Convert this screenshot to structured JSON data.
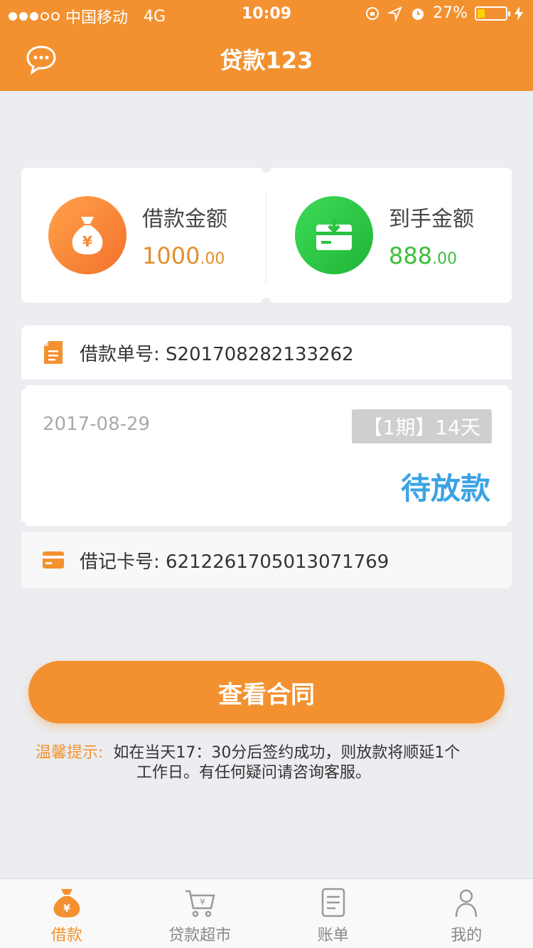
{
  "status_bar": {
    "carrier": "中国移动",
    "network": "4G",
    "time": "10:09",
    "battery": "27%",
    "battery_level": 0.27
  },
  "nav": {
    "title": "贷款123",
    "left_icon": "chat-bubble-icon"
  },
  "amounts": {
    "loan": {
      "label": "借款金额",
      "integer": "1000",
      "decimal": ".00",
      "color": "#e38f2a",
      "icon": "money-bag-icon"
    },
    "received": {
      "label": "到手金额",
      "integer": "888",
      "decimal": ".00",
      "color": "#3dbf3a",
      "icon": "card-download-icon"
    }
  },
  "order": {
    "number_label": "借款单号: S201708282133262",
    "date": "2017-08-29",
    "period": "【1期】14天",
    "status": "待放款",
    "card_label": "借记卡号: 6212261705013071769"
  },
  "button": {
    "label": "查看合同"
  },
  "tip": {
    "label": "温馨提示:",
    "line1": "如在当天17：30分后签约成功，则放款将顺延1个",
    "line2": "工作日。有任何疑问请咨询客服。"
  },
  "tabs": [
    {
      "label": "借款",
      "icon": "money-bag-icon",
      "active": true
    },
    {
      "label": "贷款超市",
      "icon": "shopping-cart-icon",
      "active": false
    },
    {
      "label": "账单",
      "icon": "bill-icon",
      "active": false
    },
    {
      "label": "我的",
      "icon": "person-icon",
      "active": false
    }
  ],
  "colors": {
    "primary": "#f39130",
    "status_blue": "#3ba3e5",
    "background": "#ebedf0"
  }
}
